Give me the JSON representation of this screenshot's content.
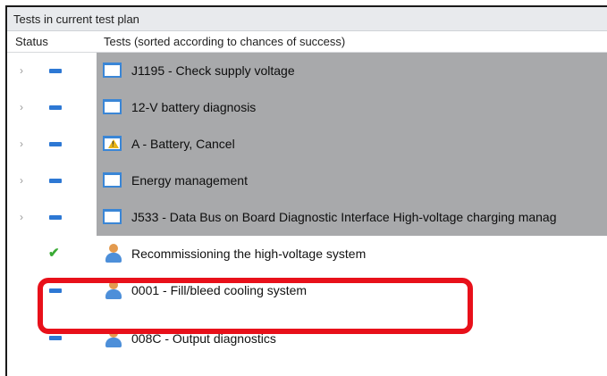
{
  "panel": {
    "title": "Tests in current test plan"
  },
  "columns": {
    "status": "Status",
    "tests": "Tests (sorted according to chances of success)"
  },
  "colors": {
    "selection": "#a8a9ab",
    "status_pending": "#2d78d4",
    "status_done": "#3aaa35",
    "highlight": "#e8101a"
  },
  "rows": [
    {
      "label": "J1195 -  Check supply voltage",
      "status": "pending",
      "icon": "document-icon",
      "expandable": true,
      "selected": true
    },
    {
      "label": "12-V battery diagnosis",
      "status": "pending",
      "icon": "document-icon",
      "expandable": true,
      "selected": true
    },
    {
      "label": "A - Battery, Cancel",
      "status": "pending",
      "icon": "warning-document-icon",
      "expandable": true,
      "selected": true
    },
    {
      "label": "Energy management",
      "status": "pending",
      "icon": "document-icon",
      "expandable": true,
      "selected": true
    },
    {
      "label": "J533 - Data Bus on Board Diagnostic Interface  High-voltage charging manag",
      "status": "pending",
      "icon": "document-icon",
      "expandable": true,
      "selected": true
    },
    {
      "label": "Recommissioning the high-voltage system",
      "status": "done",
      "icon": "person-icon",
      "expandable": false,
      "selected": false
    },
    {
      "label": "0001 - Fill/bleed cooling system",
      "status": "pending",
      "icon": "person-icon",
      "expandable": false,
      "selected": false,
      "highlighted": true
    },
    {
      "label": "008C - Output diagnostics",
      "status": "pending",
      "icon": "person-icon",
      "expandable": false,
      "selected": false
    }
  ],
  "chevron": "›",
  "check": "✔"
}
